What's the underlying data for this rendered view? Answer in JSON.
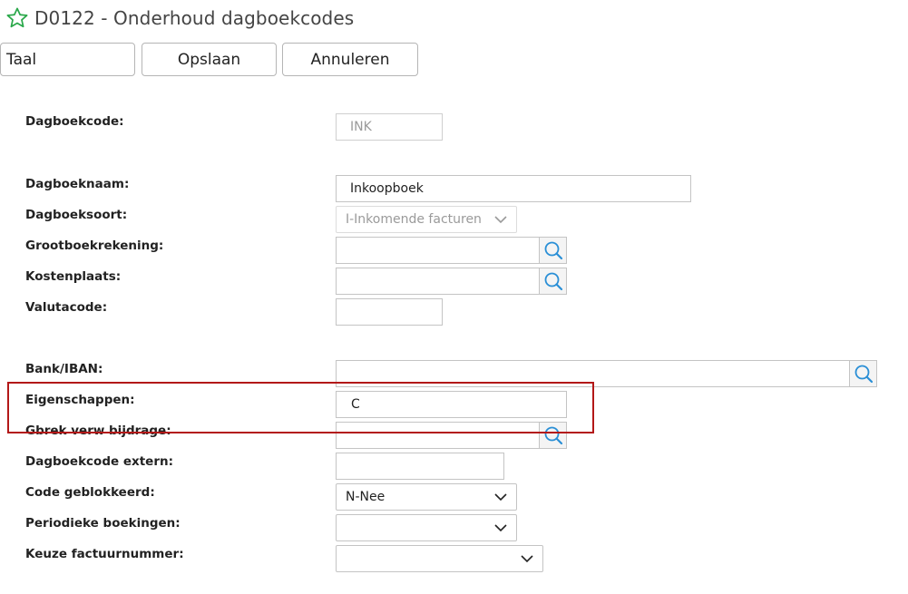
{
  "header": {
    "title": "D0122 - Onderhoud dagboekcodes"
  },
  "toolbar": {
    "taal": "Taal",
    "opslaan": "Opslaan",
    "annuleren": "Annuleren"
  },
  "form": {
    "dagboekcode": {
      "label": "Dagboekcode:",
      "value": "INK"
    },
    "dagboeknaam": {
      "label": "Dagboeknaam:",
      "value": "Inkoopboek"
    },
    "dagboeksoort": {
      "label": "Dagboeksoort:",
      "value": "I-Inkomende facturen"
    },
    "grootboekrekening": {
      "label": "Grootboekrekening:",
      "value": ""
    },
    "kostenplaats": {
      "label": "Kostenplaats:",
      "value": ""
    },
    "valutacode": {
      "label": "Valutacode:",
      "value": ""
    },
    "bank_iban": {
      "label": "Bank/IBAN:",
      "value": ""
    },
    "eigenschappen": {
      "label": "Eigenschappen:",
      "value": "C"
    },
    "gbrek_verw_bijdrage": {
      "label": "Gbrek verw bijdrage:",
      "value": ""
    },
    "dagboekcode_extern": {
      "label": "Dagboekcode extern:",
      "value": ""
    },
    "code_geblokkeerd": {
      "label": "Code geblokkeerd:",
      "value": "N-Nee"
    },
    "periodieke_boekingen": {
      "label": "Periodieke boekingen:",
      "value": ""
    },
    "keuze_factuurnummer": {
      "label": "Keuze factuurnummer:",
      "value": ""
    }
  },
  "icons": {
    "favorite": "star-icon",
    "lookup": "search-icon",
    "dropdown": "chevron-down-icon"
  },
  "colors": {
    "star": "#2aa84a",
    "lookup": "#2a8fd6",
    "highlight": "#b31818"
  }
}
